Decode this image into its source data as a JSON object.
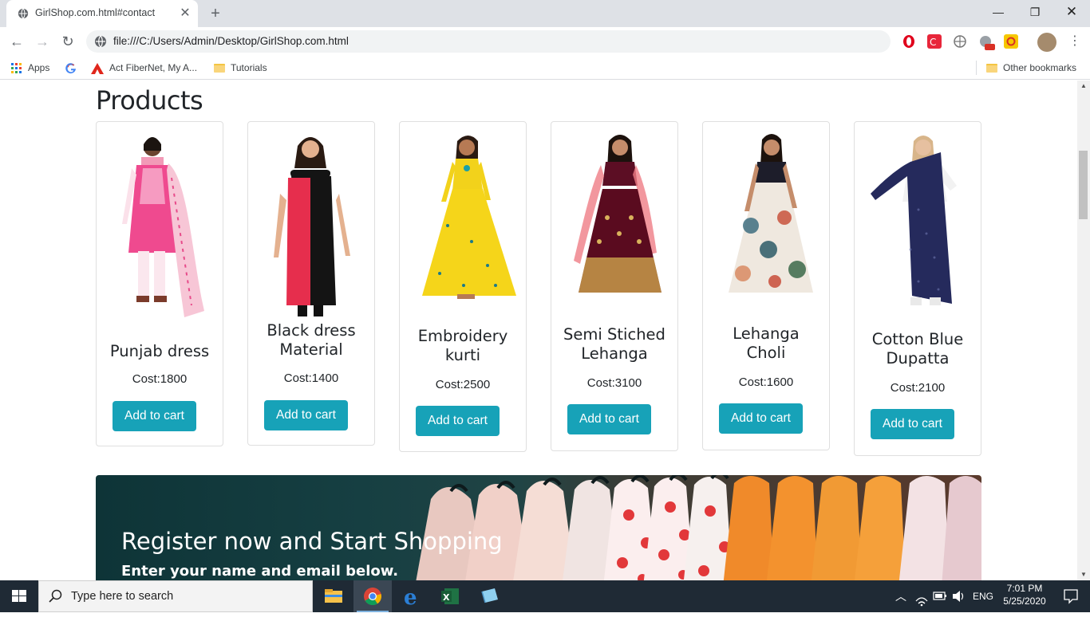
{
  "browser": {
    "tab_title": "GirlShop.com.html#contact",
    "url": "file:///C:/Users/Admin/Desktop/GirlShop.com.html",
    "bookmarks": {
      "apps": "Apps",
      "g": "",
      "actfibernet": "Act FiberNet, My A...",
      "tutorials": "Tutorials",
      "other": "Other bookmarks"
    }
  },
  "page": {
    "products_heading": "Products",
    "products": [
      {
        "name_line1": "Punjab dress",
        "name_line2": "",
        "cost": "Cost:1800",
        "button": "Add to cart",
        "image": "pink-salwar-suit-image"
      },
      {
        "name_line1": "Black dress",
        "name_line2": "Material",
        "cost": "Cost:1400",
        "button": "Add to cart",
        "image": "black-red-kurti-image"
      },
      {
        "name_line1": "Embroidery",
        "name_line2": "kurti",
        "cost": "Cost:2500",
        "button": "Add to cart",
        "image": "yellow-anarkali-image"
      },
      {
        "name_line1": "Semi Stiched",
        "name_line2": "Lehanga",
        "cost": "Cost:3100",
        "button": "Add to cart",
        "image": "maroon-lehenga-image"
      },
      {
        "name_line1": "Lehanga",
        "name_line2": "Choli",
        "cost": "Cost:1600",
        "button": "Add to cart",
        "image": "floral-lehenga-image"
      },
      {
        "name_line1": "Cotton Blue",
        "name_line2": "Dupatta",
        "cost": "Cost:2100",
        "button": "Add to cart",
        "image": "blue-dupatta-image"
      }
    ],
    "banner": {
      "title": "Register now and Start Shopping",
      "subtitle": "Enter your name and email below."
    },
    "accent_color": "#17a2b8"
  },
  "taskbar": {
    "search_placeholder": "Type here to search",
    "language": "ENG",
    "time": "7:01 PM",
    "date": "5/25/2020"
  }
}
